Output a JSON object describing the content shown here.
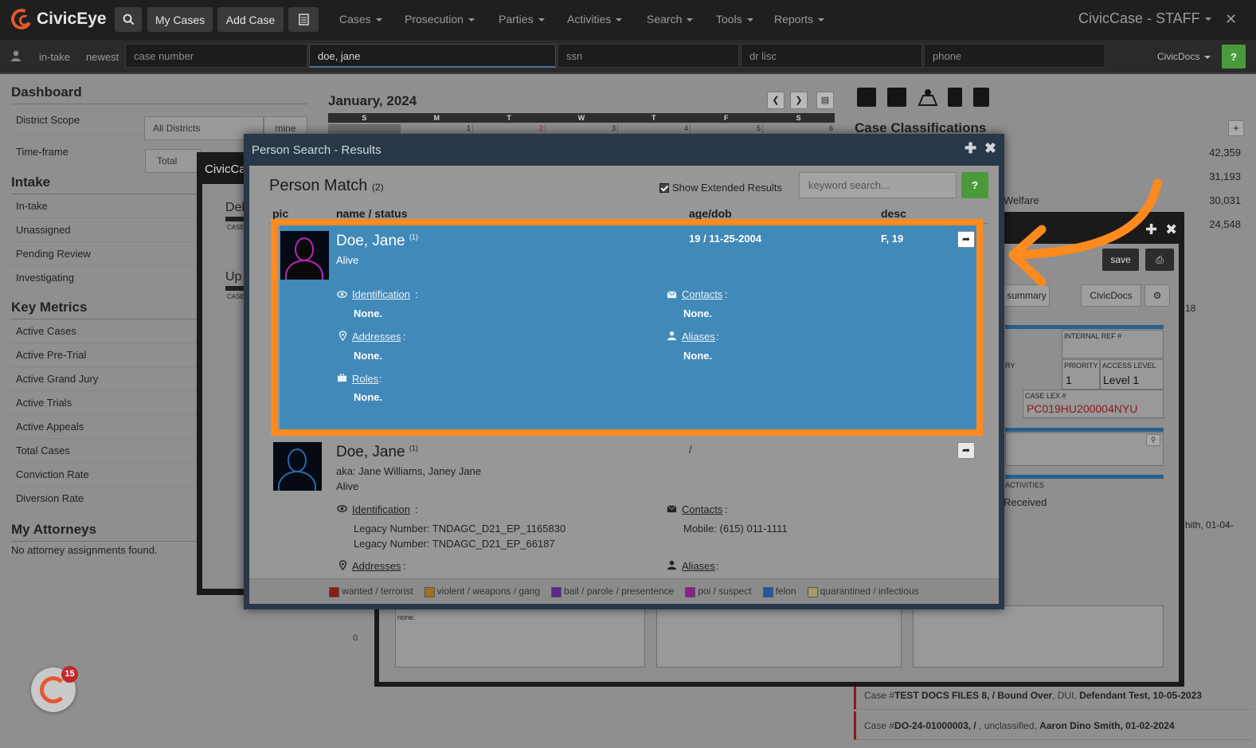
{
  "topbar": {
    "app_name": "CivicEye",
    "my_cases": "My Cases",
    "add_case": "Add Case",
    "menus": [
      "Cases",
      "Prosecution",
      "Parties",
      "Activities",
      "Search",
      "Tools",
      "Reports"
    ],
    "brand_right": "CivicCase - STAFF",
    "close": "✕"
  },
  "searchbar": {
    "links": [
      "in-take",
      "newest"
    ],
    "case_number_placeholder": "case number",
    "name_value": "doe, jane",
    "ssn_placeholder": "ssn",
    "dr_lisc_placeholder": "dr lisc",
    "phone_placeholder": "phone",
    "civicdocs": "CivicDocs",
    "help": "?"
  },
  "dashboard": {
    "title": "Dashboard",
    "district_scope_label": "District Scope",
    "district_scope_value": "All Districts",
    "mine": "mine",
    "timeframe_label": "Time-frame",
    "timeframe_value": "Total",
    "intake_title": "Intake",
    "intake_items": [
      "In-take",
      "Unassigned",
      "Pending Review",
      "Investigating"
    ],
    "metrics_title": "Key Metrics",
    "metrics_items": [
      "Active Cases",
      "Active Pre-Trial",
      "Active Grand Jury",
      "Active Trials",
      "Active Appeals",
      "Total Cases",
      "Conviction Rate",
      "Diversion Rate"
    ],
    "attorneys_title": "My Attorneys",
    "attorneys_empty": "No attorney assignments found."
  },
  "calendar": {
    "title": "January, 2024",
    "days": [
      "S",
      "M",
      "T",
      "W",
      "T",
      "F",
      "S"
    ],
    "dates": [
      "",
      "1",
      "2",
      "3",
      "4",
      "5",
      "6"
    ]
  },
  "right_panel": {
    "title": "Case Classifications",
    "plus": "+",
    "values": [
      "42,359",
      "31,193",
      "30,031",
      "24,548"
    ],
    "welfare": "Welfare",
    "cases": [
      {
        "prefix": "Case #",
        "id": "TEST DOCS FILES 8, / Bound Over",
        "mid": ", DUI, ",
        "person": "Defendant Test, 10-05-2023"
      },
      {
        "prefix": "Case #",
        "id": "DO-24-01000003, / ",
        "mid": ", unclassified, ",
        "person": "Aaron Dino Smith, 01-02-2024"
      }
    ]
  },
  "bg_window": {
    "save": "save",
    "summary": "summary",
    "civicdocs": "CivicDocs",
    "internal_ref_label": "INTERNAL REF #",
    "priority_label": "PRIORITY",
    "priority_value": "1",
    "access_level_label": "ACCESS LEVEL",
    "access_level_value": "Level 1",
    "ry_label": "RY",
    "case_lex_label": "CASE LEX #",
    "case_lex_value": "PC019HU200004NYU",
    "activities_label": "ACTIVITIES",
    "received": "Received",
    "num18": "18",
    "smith_partial": "hith, 01-04-",
    "none_small": "none.",
    "zero": "0",
    "left_win_title": "CivicCa",
    "del_partial": "Del",
    "up_partial": "Up",
    "case_small": "CASE"
  },
  "modal": {
    "title": "Person Search - Results",
    "plus": "✚",
    "close": "✖",
    "heading": "Person Match",
    "count": "(2)",
    "show_extended": "Show Extended Results",
    "keyword_placeholder": "keyword search...",
    "help": "?",
    "columns": {
      "pic": "pic",
      "name": "name / status",
      "age": "age/dob",
      "desc": "desc"
    },
    "results": [
      {
        "name": "Doe, Jane",
        "sup": "(1)",
        "aka": "",
        "status": "Alive",
        "age_dob": "19 / 11-25-2004",
        "desc": "F, 19",
        "identification_label": "Identification",
        "identification": [
          "None."
        ],
        "contacts_label": "Contacts",
        "contacts": [
          "None."
        ],
        "addresses_label": "Addresses",
        "addresses": [
          "None."
        ],
        "aliases_label": "Aliases",
        "aliases": [
          "None."
        ],
        "roles_label": "Roles",
        "roles": [
          "None."
        ]
      },
      {
        "name": "Doe, Jane",
        "sup": "(1)",
        "aka": "aka: Jane Williams, Janey Jane",
        "status": "Alive",
        "age_dob": "/",
        "desc": "",
        "identification_label": "Identification",
        "identification": [
          "Legacy Number: TNDAGC_D21_EP_1165830",
          "Legacy Number: TNDAGC_D21_EP_66187"
        ],
        "contacts_label": "Contacts",
        "contacts": [
          "Mobile: (615) 011-1111"
        ],
        "addresses_label": "Addresses",
        "aliases_label": "Aliases"
      }
    ],
    "legend": [
      {
        "label": "wanted / terrorist",
        "color": "#8b1a1a"
      },
      {
        "label": "violent / weapons / gang",
        "color": "#a0701e"
      },
      {
        "label": "bail / parole / presentence",
        "color": "#5b2a8c"
      },
      {
        "label": "poi / suspect",
        "color": "#8a1f8a"
      },
      {
        "label": "felon",
        "color": "#2157a0"
      },
      {
        "label": "quarantined / infectious",
        "color": "#a89a6a"
      }
    ]
  },
  "notification": {
    "count": "15"
  }
}
